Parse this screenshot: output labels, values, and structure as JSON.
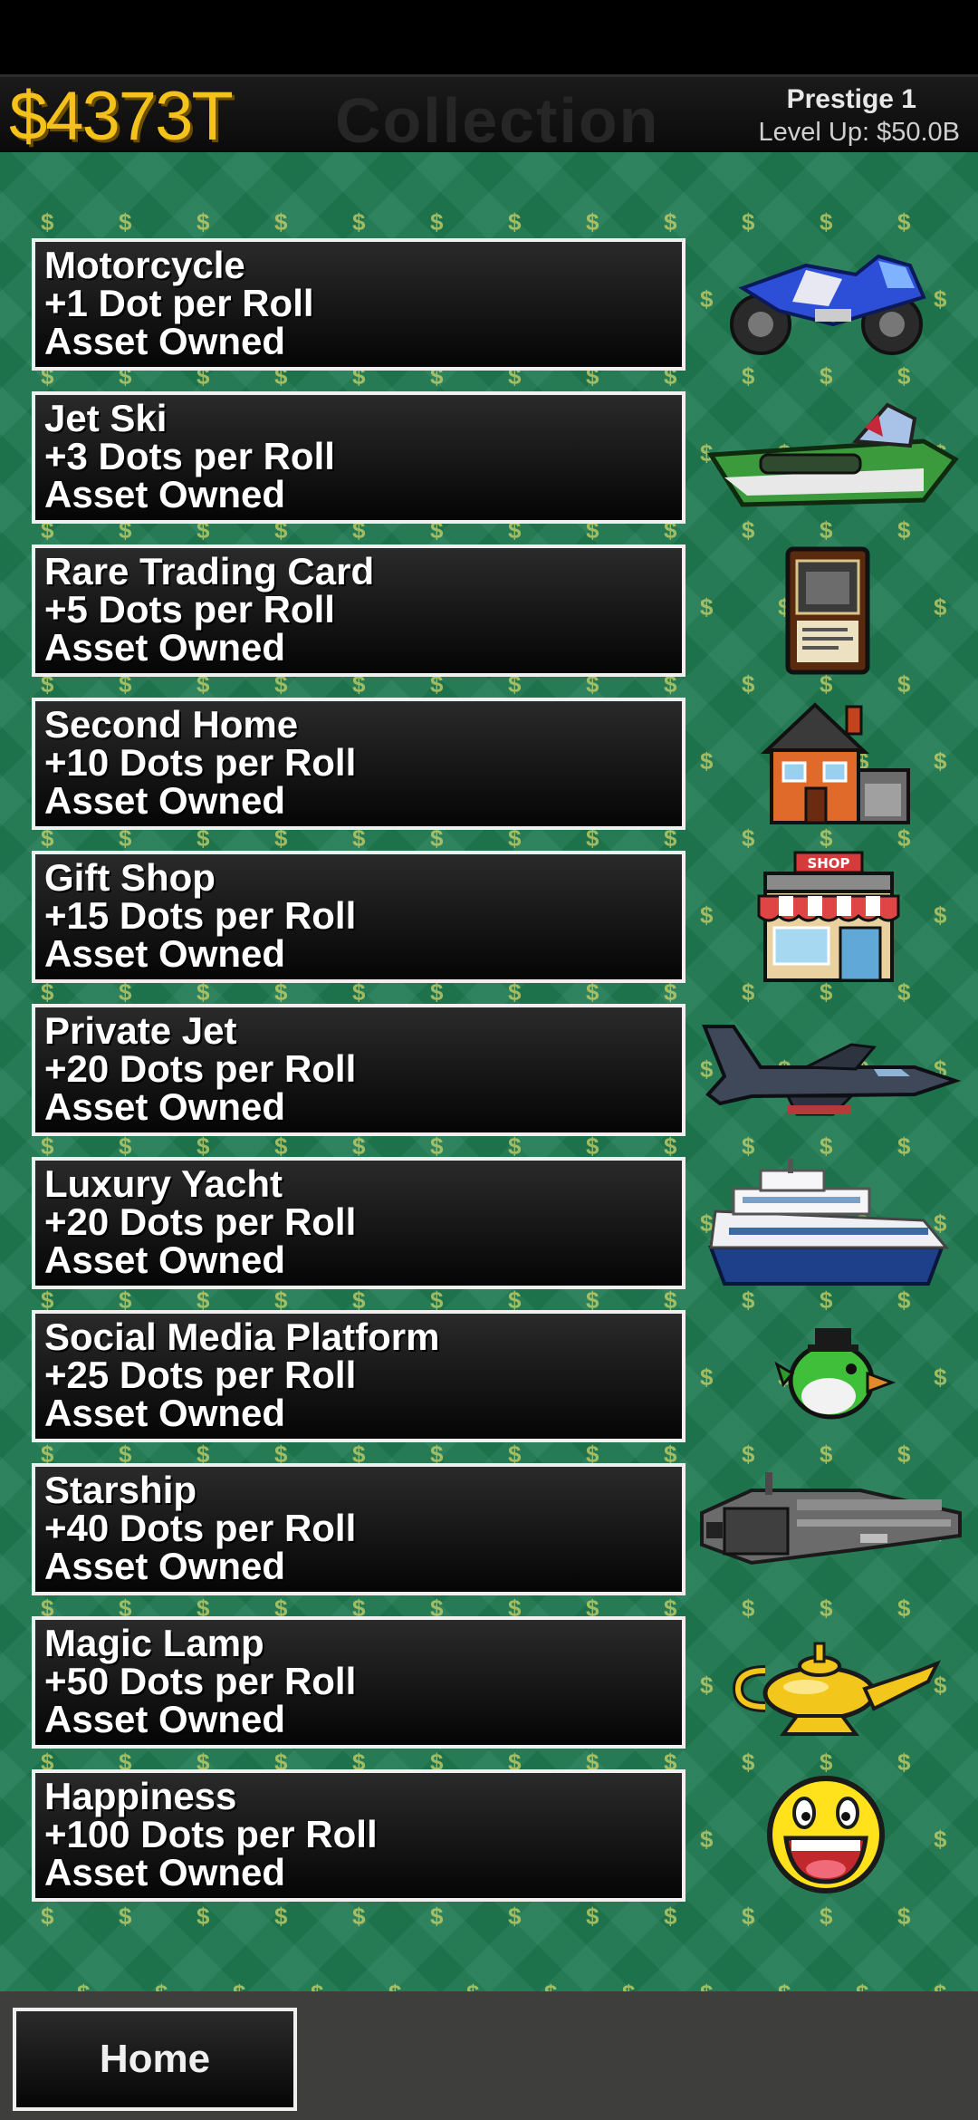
{
  "header": {
    "money": "$4373T",
    "screen_title": "Collection",
    "prestige_label": "Prestige 1",
    "level_up": "Level Up: $50.0B"
  },
  "assets": [
    {
      "name": "Motorcycle",
      "bonus": "+1 Dot per Roll",
      "status": "Asset Owned",
      "icon": "motorcycle-icon"
    },
    {
      "name": "Jet Ski",
      "bonus": "+3 Dots per Roll",
      "status": "Asset Owned",
      "icon": "jet-ski-icon"
    },
    {
      "name": "Rare Trading Card",
      "bonus": "+5 Dots per Roll",
      "status": "Asset Owned",
      "icon": "trading-card-icon"
    },
    {
      "name": "Second Home",
      "bonus": "+10 Dots per Roll",
      "status": "Asset Owned",
      "icon": "house-icon"
    },
    {
      "name": "Gift Shop",
      "bonus": "+15 Dots per Roll",
      "status": "Asset Owned",
      "icon": "shop-icon",
      "icon_text": "SHOP"
    },
    {
      "name": "Private Jet",
      "bonus": "+20 Dots per Roll",
      "status": "Asset Owned",
      "icon": "jet-icon"
    },
    {
      "name": "Luxury Yacht",
      "bonus": "+20 Dots per Roll",
      "status": "Asset Owned",
      "icon": "yacht-icon"
    },
    {
      "name": "Social Media Platform",
      "bonus": "+25 Dots per Roll",
      "status": "Asset Owned",
      "icon": "bird-icon"
    },
    {
      "name": "Starship",
      "bonus": "+40 Dots per Roll",
      "status": "Asset Owned",
      "icon": "starship-icon"
    },
    {
      "name": "Magic Lamp",
      "bonus": "+50 Dots per Roll",
      "status": "Asset Owned",
      "icon": "magic-lamp-icon"
    },
    {
      "name": "Happiness",
      "bonus": "+100 Dots per Roll",
      "status": "Asset Owned",
      "icon": "smiley-face-icon"
    }
  ],
  "footer": {
    "home_label": "Home"
  },
  "colors": {
    "money": "#f4c21b",
    "background": "#1f7a52",
    "card_border": "#f0f0f0"
  }
}
